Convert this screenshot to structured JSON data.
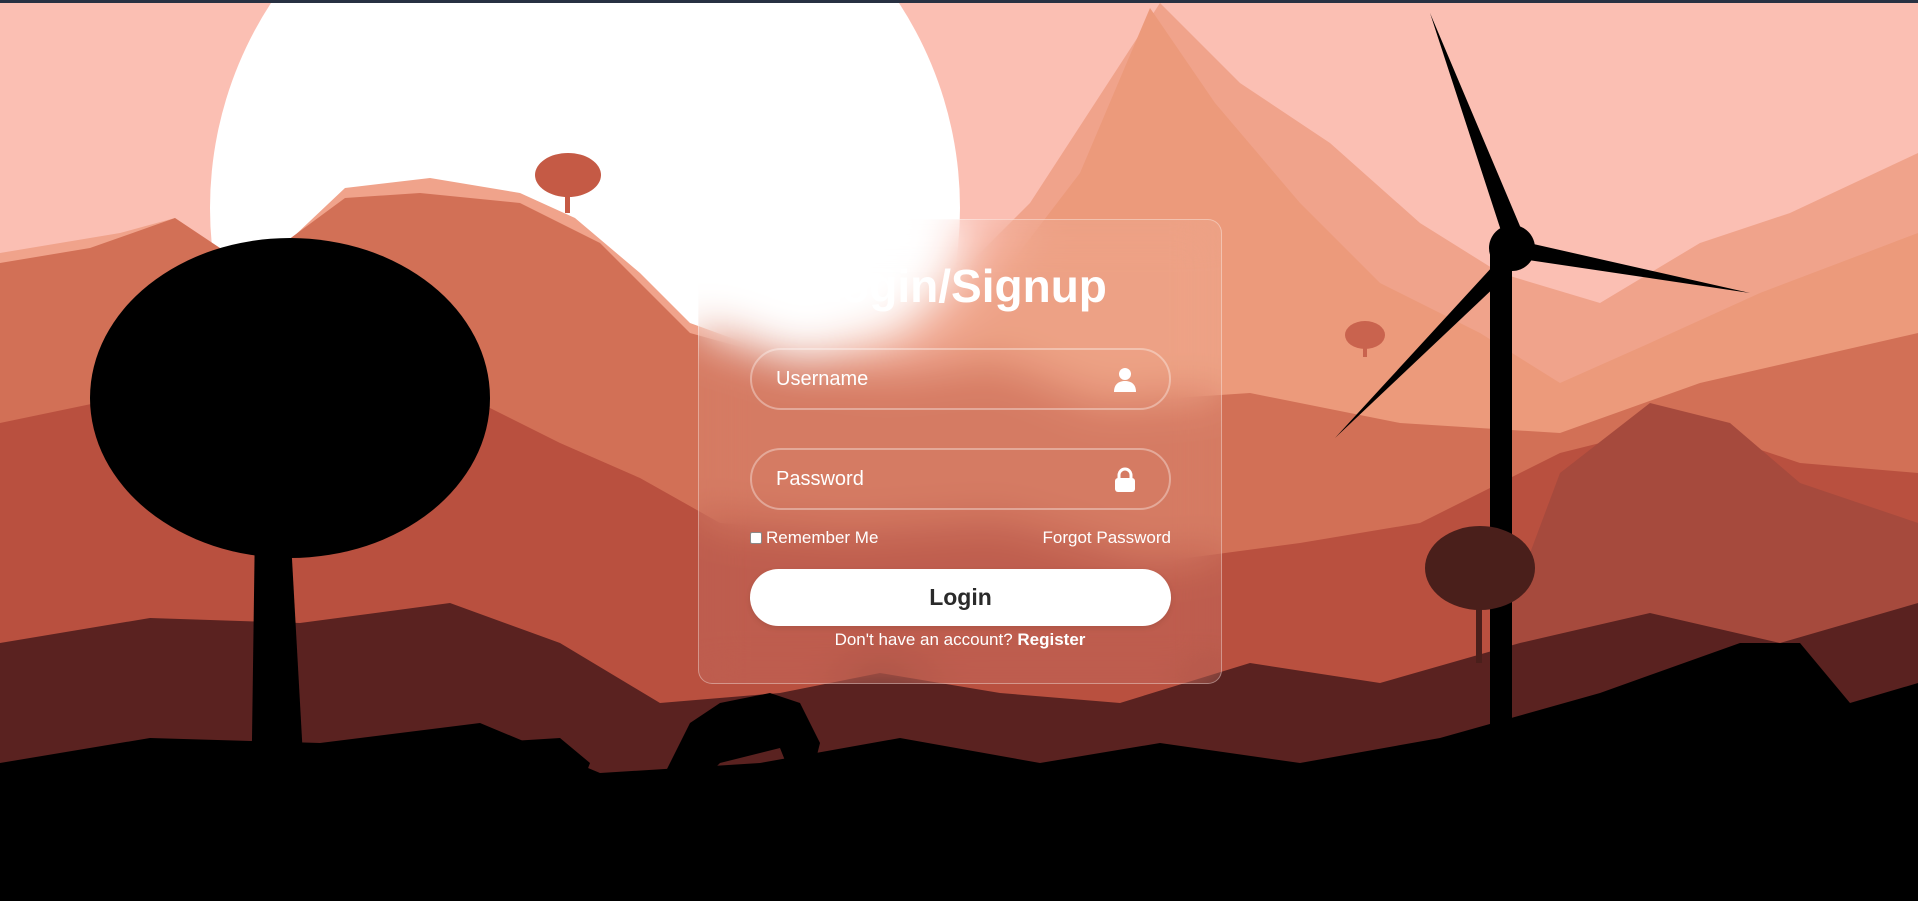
{
  "form": {
    "title": "Login/Signup",
    "username_placeholder": "Username",
    "password_placeholder": "Password",
    "remember_label": "Remember Me",
    "forgot_label": "Forgot Password",
    "login_label": "Login",
    "register_prompt": "Don't have an account?",
    "register_label": "Register"
  },
  "icons": {
    "username": "user-icon",
    "password": "lock-icon"
  },
  "colors": {
    "sky": "#fbbfb3",
    "sun": "#ffffff",
    "button_bg": "#ffffff",
    "silhouette": "#000000"
  }
}
